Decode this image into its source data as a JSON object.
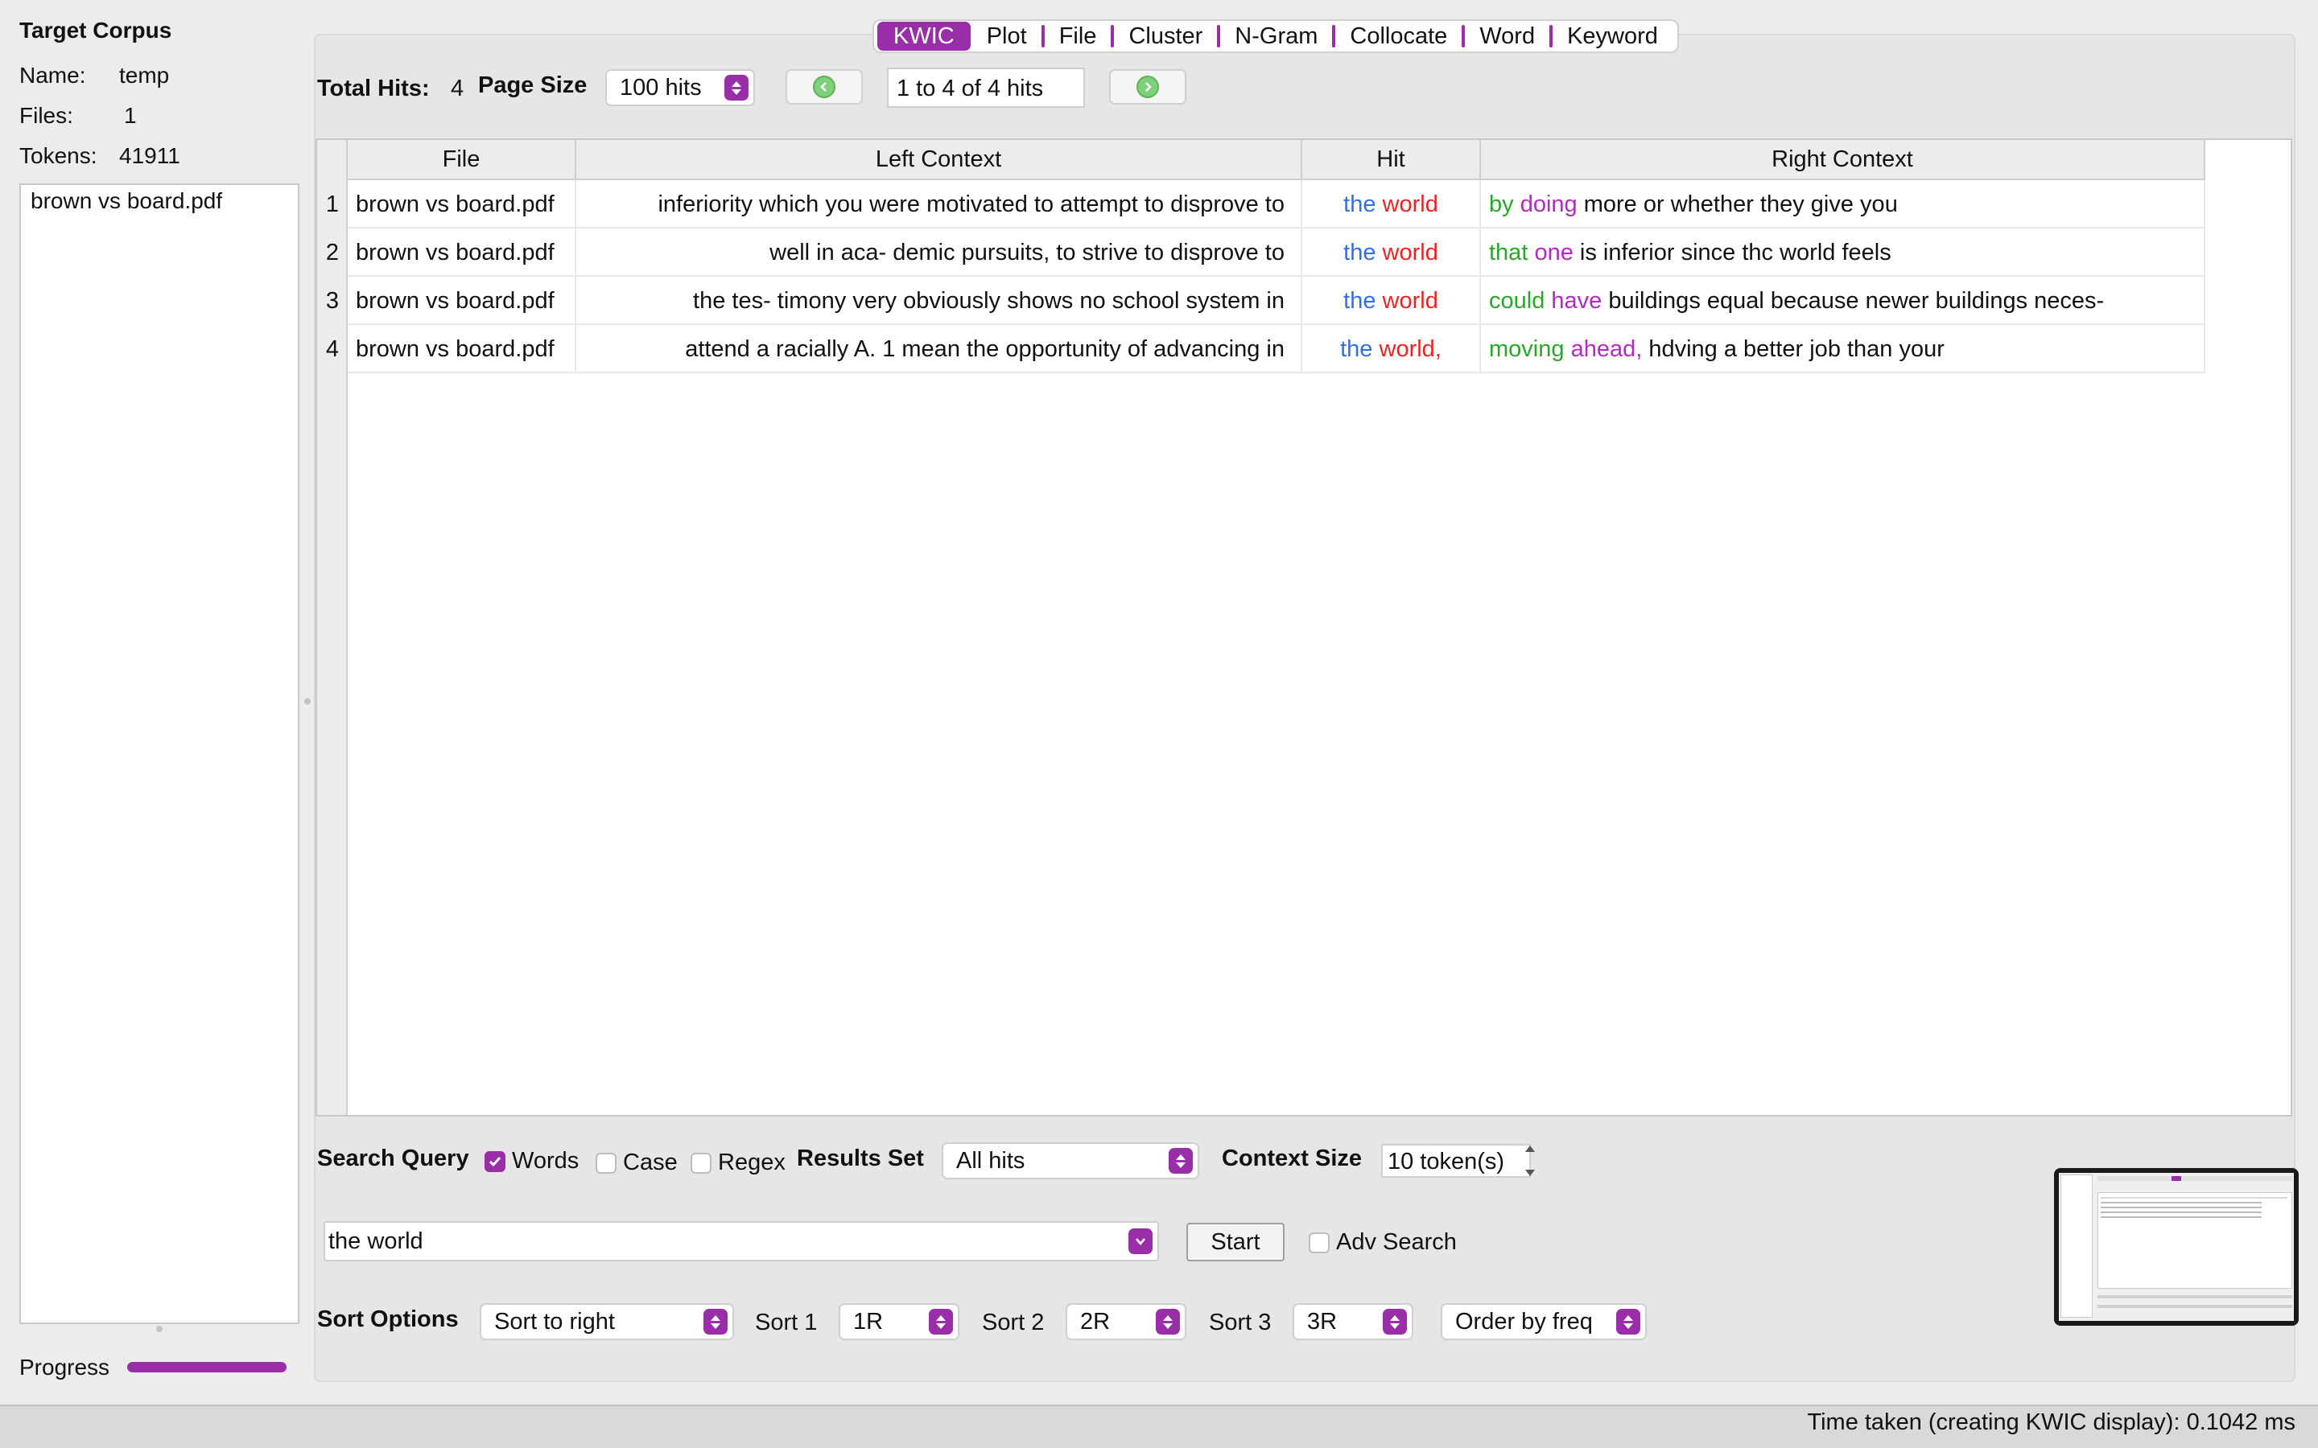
{
  "corpus": {
    "title": "Target Corpus",
    "name_label": "Name:",
    "name_value": "temp",
    "files_label": "Files:",
    "files_value": "1",
    "tokens_label": "Tokens:",
    "tokens_value": "41911",
    "file_list": [
      "brown vs board.pdf"
    ],
    "progress_label": "Progress",
    "progress": 1.0
  },
  "tabs": [
    "KWIC",
    "Plot",
    "File",
    "Cluster",
    "N-Gram",
    "Collocate",
    "Word",
    "Keyword"
  ],
  "active_tab": "KWIC",
  "toolbar": {
    "total_hits_label": "Total Hits:",
    "total_hits_value": "4",
    "page_size_label": "Page Size",
    "page_size_value": "100 hits",
    "hits_range": "1 to 4 of 4 hits"
  },
  "table": {
    "headers": [
      "File",
      "Left Context",
      "Hit",
      "Right Context"
    ],
    "rows": [
      {
        "n": "1",
        "file": "brown vs board.pdf",
        "left": "inferiority which you were motivated to attempt to disprove to",
        "hit1": "the",
        "hit2": "world",
        "r1": "by",
        "r2": "doing",
        "rest": "more or whether they give you"
      },
      {
        "n": "2",
        "file": "brown vs board.pdf",
        "left": "well in aca- demic pursuits, to strive to disprove to",
        "hit1": "the",
        "hit2": "world",
        "r1": "that",
        "r2": "one",
        "rest": "is inferior since thc world feels"
      },
      {
        "n": "3",
        "file": "brown vs board.pdf",
        "left": "the tes- timony very obviously shows no school system in",
        "hit1": "the",
        "hit2": "world",
        "r1": "could",
        "r2": "have",
        "rest": "buildings equal because newer buildings neces-"
      },
      {
        "n": "4",
        "file": "brown vs board.pdf",
        "left": "attend a racially A. 1 mean the opportunity of advancing in",
        "hit1": "the",
        "hit2": "world,",
        "r1": "moving",
        "r2": "ahead,",
        "rest": "hdving a better job than your"
      }
    ]
  },
  "search": {
    "query_label": "Search Query",
    "words_label": "Words",
    "words_checked": true,
    "case_label": "Case",
    "case_checked": false,
    "regex_label": "Regex",
    "regex_checked": false,
    "results_set_label": "Results Set",
    "results_set_value": "All hits",
    "context_size_label": "Context Size",
    "context_size_value": "10 token(s)",
    "query_value": "the world",
    "start_label": "Start",
    "adv_label": "Adv Search",
    "adv_checked": false
  },
  "sort": {
    "options_label": "Sort Options",
    "mode_value": "Sort to right",
    "sort1_label": "Sort 1",
    "sort1_value": "1R",
    "sort2_label": "Sort 2",
    "sort2_value": "2R",
    "sort3_label": "Sort 3",
    "sort3_value": "3R",
    "order_value": "Order by freq"
  },
  "status": {
    "text": "Time taken (creating KWIC display): 0.1042 ms"
  },
  "colors": {
    "accent": "#9a2ea8",
    "hit_first": "#2f6fe8",
    "hit_second": "#ea2323",
    "right_1": "#2aa72a",
    "right_2": "#b22ac0"
  }
}
